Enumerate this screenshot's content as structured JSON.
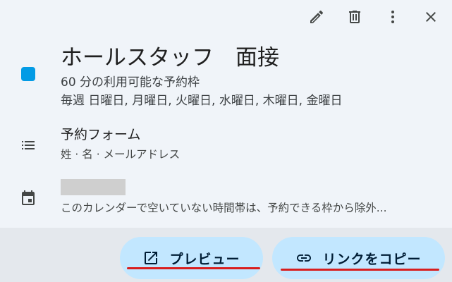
{
  "toolbar": {
    "edit_icon": "pencil-icon",
    "delete_icon": "trash-icon",
    "more_icon": "more-vert-icon",
    "close_icon": "close-icon"
  },
  "event": {
    "title": "ホールスタッフ　面接",
    "color": "#039be5",
    "availability": "60 分の利用可能な予約枠",
    "recurrence": "毎週 日曜日, 月曜日, 火曜日, 水曜日, 木曜日, 金曜日"
  },
  "booking_form": {
    "title": "予約フォーム",
    "fields": "姓 · 名 · メールアドレス"
  },
  "calendar": {
    "description": "このカレンダーで空いていない時間帯は、予約できる枠から除外..."
  },
  "actions": {
    "preview_label": "プレビュー",
    "copy_link_label": "リンクをコピー"
  },
  "colors": {
    "accent_button": "#c2e7ff",
    "underline": "#d81e1e"
  }
}
